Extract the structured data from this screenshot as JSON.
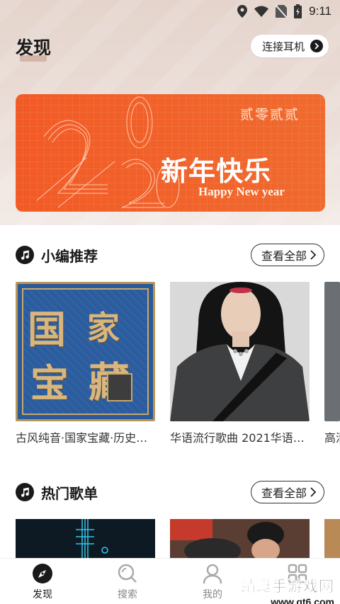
{
  "status_bar": {
    "time": "9:11"
  },
  "header": {
    "title": "发现",
    "connect_button": "连接耳机"
  },
  "banner": {
    "top_text": "贰零贰贰",
    "main_text": "新年快乐",
    "sub_text": "Happy New year",
    "accent_color": "#f25a25"
  },
  "sections": [
    {
      "title": "小编推荐",
      "see_all": "查看全部",
      "cards": [
        {
          "caption": "古风纯音·国家宝藏·历史…",
          "cover_text": [
            "国",
            "家",
            "宝",
            "藏"
          ]
        },
        {
          "caption": "华语流行歌曲 2021华语…"
        },
        {
          "caption": "高清"
        }
      ]
    },
    {
      "title": "热门歌单",
      "see_all": "查看全部"
    }
  ],
  "nav": [
    {
      "label": "发现",
      "icon": "compass-icon",
      "active": true
    },
    {
      "label": "搜索",
      "icon": "search-icon",
      "active": false
    },
    {
      "label": "我的",
      "icon": "user-icon",
      "active": false
    },
    {
      "label": "",
      "icon": "grid-icon",
      "active": false
    }
  ],
  "watermark": {
    "line1": "蜻蜓手游戏网",
    "line2": "www.qt6.com"
  }
}
